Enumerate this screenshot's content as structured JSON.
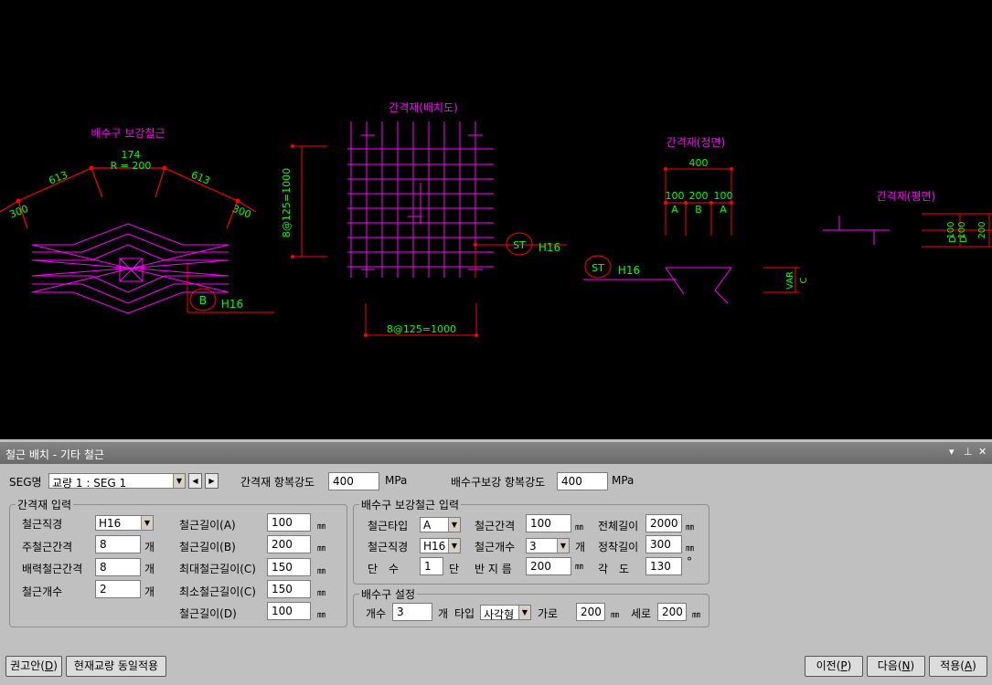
{
  "drawing": {
    "title_drain": "배수구 보강철근",
    "drain_dims": {
      "d174": "174",
      "r200": "R = 200",
      "d613a": "613",
      "d613b": "613",
      "d300a": "300",
      "d300b": "300"
    },
    "drain_tag": "B",
    "drain_rebar": "H16",
    "title_spacer_plan": "간격재(배치도)",
    "spacer_vert_dim": "8@125=1000",
    "spacer_horz_dim": "8@125=1000",
    "spacer_tag": "ST",
    "spacer_rebar": "H16",
    "title_front": "간격재(정면)",
    "front_dims": {
      "d400": "400",
      "d100a": "100",
      "d200": "200",
      "d100b": "100",
      "a1": "A",
      "b": "B",
      "a2": "A"
    },
    "front_tag": "ST",
    "front_rebar": "H16",
    "front_var": "VAR",
    "front_c": "C",
    "title_plan": "간격재(평면)",
    "plan_dims": {
      "d100a": "100",
      "d100b": "100",
      "dD1": "D",
      "dD2": "D",
      "d200": "200"
    },
    "colors": {
      "magenta": "#ff00ff",
      "green": "#00ff00",
      "red": "#ff0000",
      "white": "#ffffff",
      "canvas": "#000000"
    }
  },
  "panel": {
    "title": "철근 배치 - 기타 철근",
    "title_controls": {
      "dropdown": "▾",
      "pin": "₩",
      "close": "✕"
    },
    "seg_label": "SEG명",
    "seg_value": "교량 1 : SEG 1",
    "spacer_strength_label": "간격재 항복강도",
    "spacer_strength_value": "400",
    "mpa1": "MPa",
    "drain_strength_label": "배수구보강 항복강도",
    "drain_strength_value": "400",
    "mpa2": "MPa",
    "spacer_group": {
      "title": "간격재 입력",
      "dia_label": "철근직경",
      "dia_value": "H16",
      "main_spacing_label": "주철근간격",
      "main_spacing_value": "8",
      "main_spacing_unit": "개",
      "dist_spacing_label": "배력철근간격",
      "dist_spacing_value": "8",
      "dist_spacing_unit": "개",
      "count_label": "철근개수",
      "count_value": "2",
      "count_unit": "개",
      "len_a_label": "철근길이(A)",
      "len_a_value": "100",
      "len_b_label": "철근길이(B)",
      "len_b_value": "200",
      "max_c_label": "최대철근길이(C)",
      "max_c_value": "150",
      "min_c_label": "최소철근길이(C)",
      "min_c_value": "150",
      "len_d_label": "철근길이(D)",
      "len_d_value": "100",
      "mm": "㎜"
    },
    "drain_group": {
      "title": "배수구 보강철근 입력",
      "type_label": "철근타입",
      "type_value": "A",
      "spacing_label": "철근간격",
      "spacing_value": "100",
      "total_len_label": "전체길이",
      "total_len_value": "2000",
      "dia_label": "철근직경",
      "dia_value": "H16",
      "count_label": "철근개수",
      "count_value": "3",
      "count_unit": "개",
      "anchor_len_label": "정착길이",
      "anchor_len_value": "300",
      "tier_label": "단　수",
      "tier_value": "1",
      "tier_unit": "단",
      "radius_label": "반 지 름",
      "radius_value": "200",
      "angle_label": "각　도",
      "angle_value": "130",
      "angle_unit": "°",
      "mm": "㎜"
    },
    "drain_setting": {
      "title": "배수구 설정",
      "count_label": "개수",
      "count_value": "3",
      "count_unit": "개",
      "type_label": "타입",
      "type_value": "사각형",
      "width_label": "가로",
      "width_value": "200",
      "height_label": "세로",
      "height_value": "200",
      "mm": "㎜"
    },
    "buttons": {
      "recommend": "권고안(",
      "recommend_key": "D",
      "apply_same": "현재교량 동일적용",
      "prev": "이전(",
      "prev_key": "P",
      "next": "다음(",
      "next_key": "N",
      "apply": "적용(",
      "apply_key": "A",
      "close_paren": ")"
    }
  }
}
